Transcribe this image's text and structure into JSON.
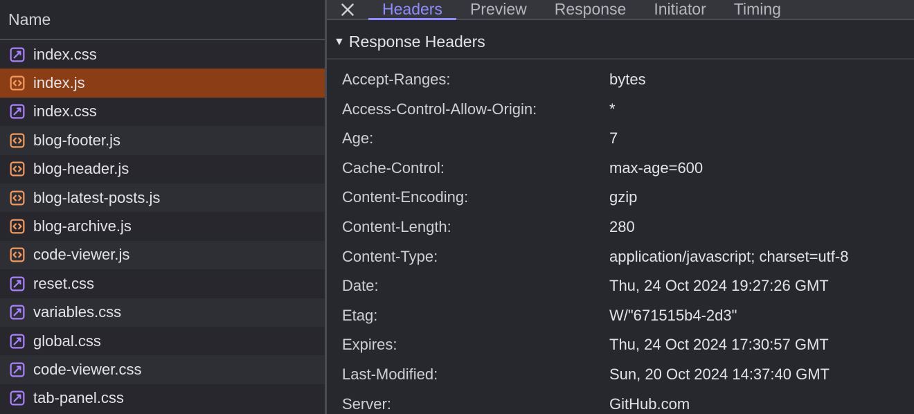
{
  "left": {
    "header": "Name",
    "selectedIndex": 1,
    "files": [
      {
        "name": "index.css",
        "kind": "css"
      },
      {
        "name": "index.js",
        "kind": "js"
      },
      {
        "name": "index.css",
        "kind": "css"
      },
      {
        "name": "blog-footer.js",
        "kind": "js"
      },
      {
        "name": "blog-header.js",
        "kind": "js"
      },
      {
        "name": "blog-latest-posts.js",
        "kind": "js"
      },
      {
        "name": "blog-archive.js",
        "kind": "js"
      },
      {
        "name": "code-viewer.js",
        "kind": "js"
      },
      {
        "name": "reset.css",
        "kind": "css"
      },
      {
        "name": "variables.css",
        "kind": "css"
      },
      {
        "name": "global.css",
        "kind": "css"
      },
      {
        "name": "code-viewer.css",
        "kind": "css"
      },
      {
        "name": "tab-panel.css",
        "kind": "css"
      }
    ]
  },
  "tabs": {
    "active": 0,
    "items": [
      "Headers",
      "Preview",
      "Response",
      "Initiator",
      "Timing"
    ]
  },
  "section": {
    "title": "Response Headers",
    "expanded": true
  },
  "headers": [
    {
      "k": "Accept-Ranges:",
      "v": "bytes"
    },
    {
      "k": "Access-Control-Allow-Origin:",
      "v": "*"
    },
    {
      "k": "Age:",
      "v": "7"
    },
    {
      "k": "Cache-Control:",
      "v": "max-age=600"
    },
    {
      "k": "Content-Encoding:",
      "v": "gzip"
    },
    {
      "k": "Content-Length:",
      "v": "280"
    },
    {
      "k": "Content-Type:",
      "v": "application/javascript; charset=utf-8"
    },
    {
      "k": "Date:",
      "v": "Thu, 24 Oct 2024 19:27:26 GMT"
    },
    {
      "k": "Etag:",
      "v": "W/\"671515b4-2d3\""
    },
    {
      "k": "Expires:",
      "v": "Thu, 24 Oct 2024 17:30:57 GMT"
    },
    {
      "k": "Last-Modified:",
      "v": "Sun, 20 Oct 2024 14:37:40 GMT"
    },
    {
      "k": "Server:",
      "v": "GitHub.com"
    }
  ],
  "iconColors": {
    "css": "#a982ff",
    "js": "#f39b5f"
  }
}
